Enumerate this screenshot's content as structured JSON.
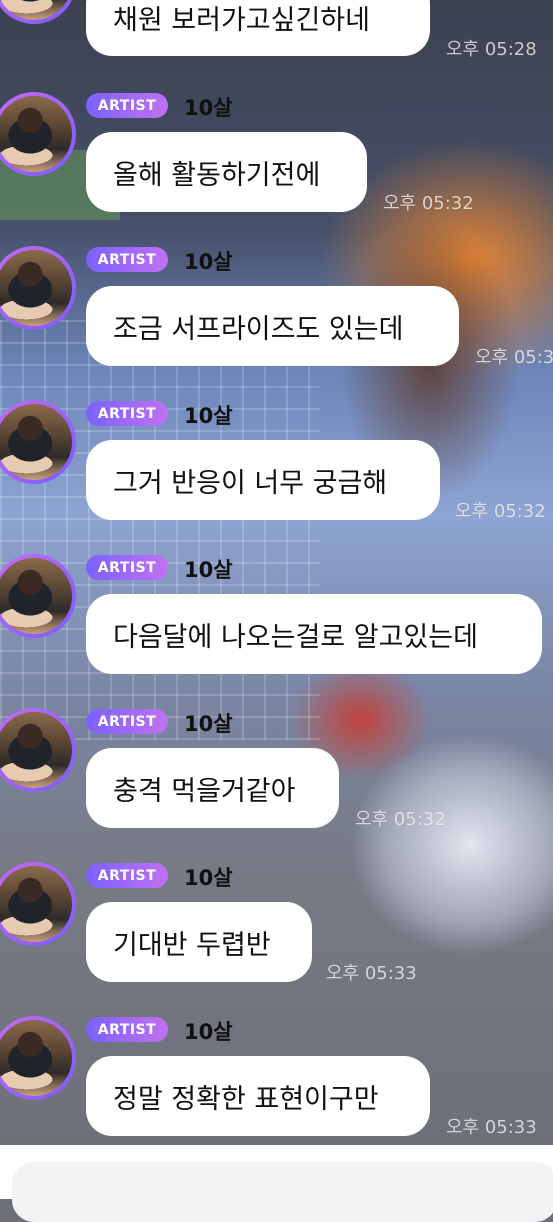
{
  "artist_tag": "ARTIST",
  "sender_name": "10살",
  "messages": [
    {
      "text": "채원 보러가고싶긴하네",
      "time": "오후 05:28"
    },
    {
      "text": "올해 활동하기전에",
      "time": "오후 05:32"
    },
    {
      "text": "조금 서프라이즈도 있는데",
      "time": "오후 05:3"
    },
    {
      "text": "그거 반응이 너무 궁금해",
      "time": "오후 05:32"
    },
    {
      "text": "다음달에 나오는걸로 알고있는데",
      "time": ""
    },
    {
      "text": "충격 먹을거같아",
      "time": "오후 05:32"
    },
    {
      "text": "기대반 두렵반",
      "time": "오후 05:33"
    },
    {
      "text": "정말 정확한 표현이구만",
      "time": "오후 05:33"
    }
  ]
}
